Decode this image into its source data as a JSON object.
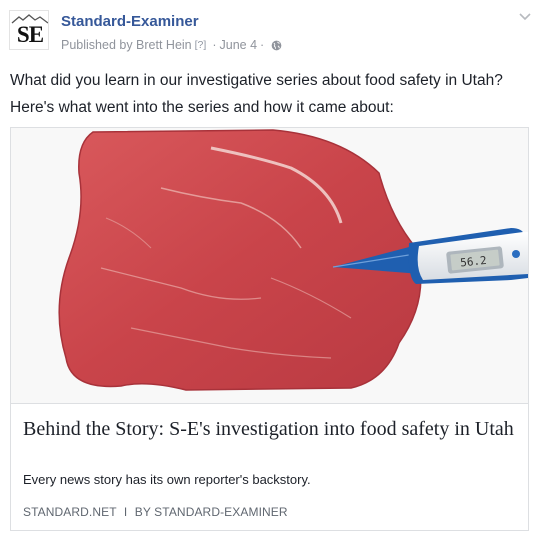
{
  "post": {
    "page_name": "Standard-Examiner",
    "logo_text": "SE",
    "published_by": "Published by Brett Hein",
    "info_marker": "[?]",
    "separator": "·",
    "date": "June 4",
    "privacy_icon": "globe-icon",
    "options_icon": "chevron-down-icon",
    "message_lines": [
      "What did you learn in our investigative series about food safety in Utah?",
      "Here's what went into the series and how it came about:"
    ]
  },
  "link_card": {
    "image_subject": "raw-steak-with-thermometer",
    "thermometer_reading": "56.2",
    "title": "Behind the Story: S-E's investigation into food safety in Utah",
    "description": "Every news story has its own reporter's backstory.",
    "domain": "STANDARD.NET",
    "divider": "I",
    "byline": "BY STANDARD-EXAMINER"
  },
  "colors": {
    "link_blue": "#365899",
    "meta_gray": "#90949c",
    "text": "#1d2129",
    "border": "#dddfe2",
    "meat_red": "#c8474c",
    "thermometer_blue": "#1f5fb0"
  }
}
